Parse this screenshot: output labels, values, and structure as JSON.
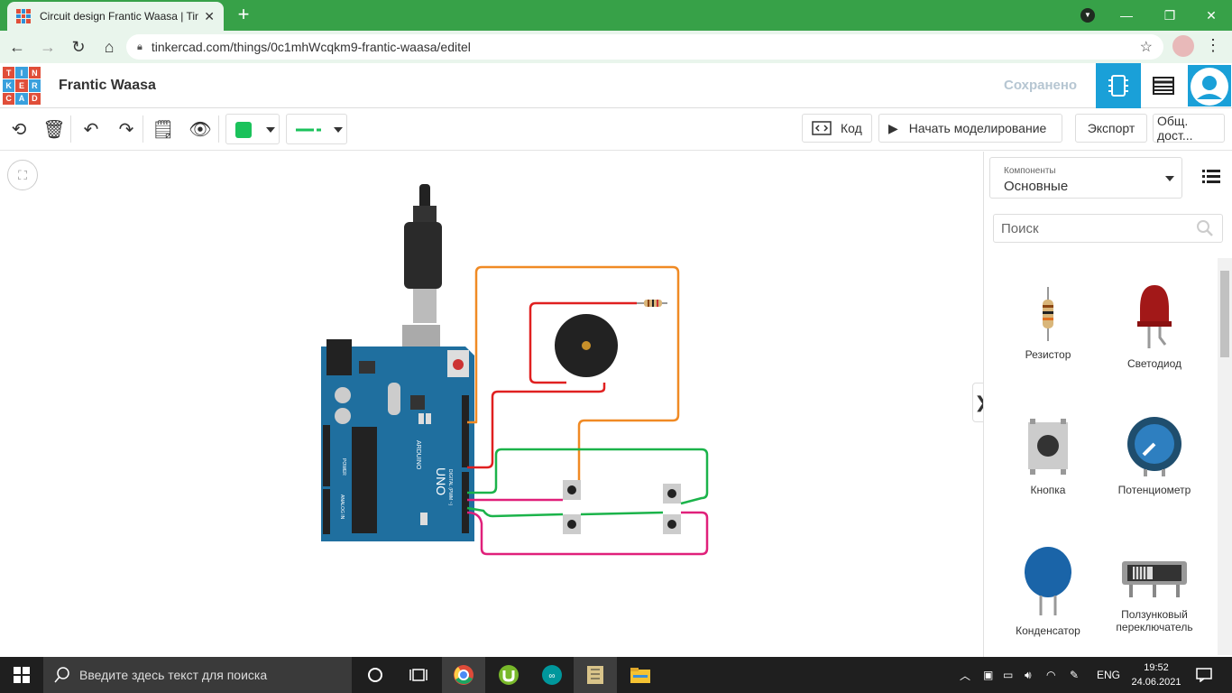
{
  "browser": {
    "tab_title": "Circuit design Frantic Waasa | Tin",
    "url": "tinkercad.com/things/0c1mhWcqkm9-frantic-waasa/editel",
    "theme_color": "#37a148"
  },
  "app": {
    "logo_letters": [
      "TIN",
      "KER",
      "CAD"
    ],
    "project_title": "Frantic Waasa",
    "save_status": "Сохранено"
  },
  "toolbar": {
    "wire_color": "#1bc25b",
    "code_label": "Код",
    "simulate_label": "Начать моделирование",
    "export_label": "Экспорт",
    "share_label": "Общ. дост..."
  },
  "panel": {
    "components_label": "Компоненты",
    "components_value": "Основные",
    "search_placeholder": "Поиск",
    "items": [
      {
        "label": "Резистор",
        "icon": "resistor-icon"
      },
      {
        "label": "Светодиод",
        "icon": "led-icon"
      },
      {
        "label": "Кнопка",
        "icon": "pushbutton-icon"
      },
      {
        "label": "Потенциометр",
        "icon": "potentiometer-icon"
      },
      {
        "label": "Конденсатор",
        "icon": "capacitor-icon"
      },
      {
        "label": "Ползунковый переключатель",
        "icon": "slide-switch-icon"
      }
    ]
  },
  "board": {
    "name": "UNO",
    "brand": "ARDUINO",
    "digital_label": "DIGITAL (PWM ~)",
    "analog_label": "ANALOG IN",
    "power_label": "POWER"
  },
  "taskbar": {
    "search_placeholder": "Введите здесь текст для поиска",
    "language": "ENG",
    "time": "19:52",
    "date": "24.06.2021"
  }
}
